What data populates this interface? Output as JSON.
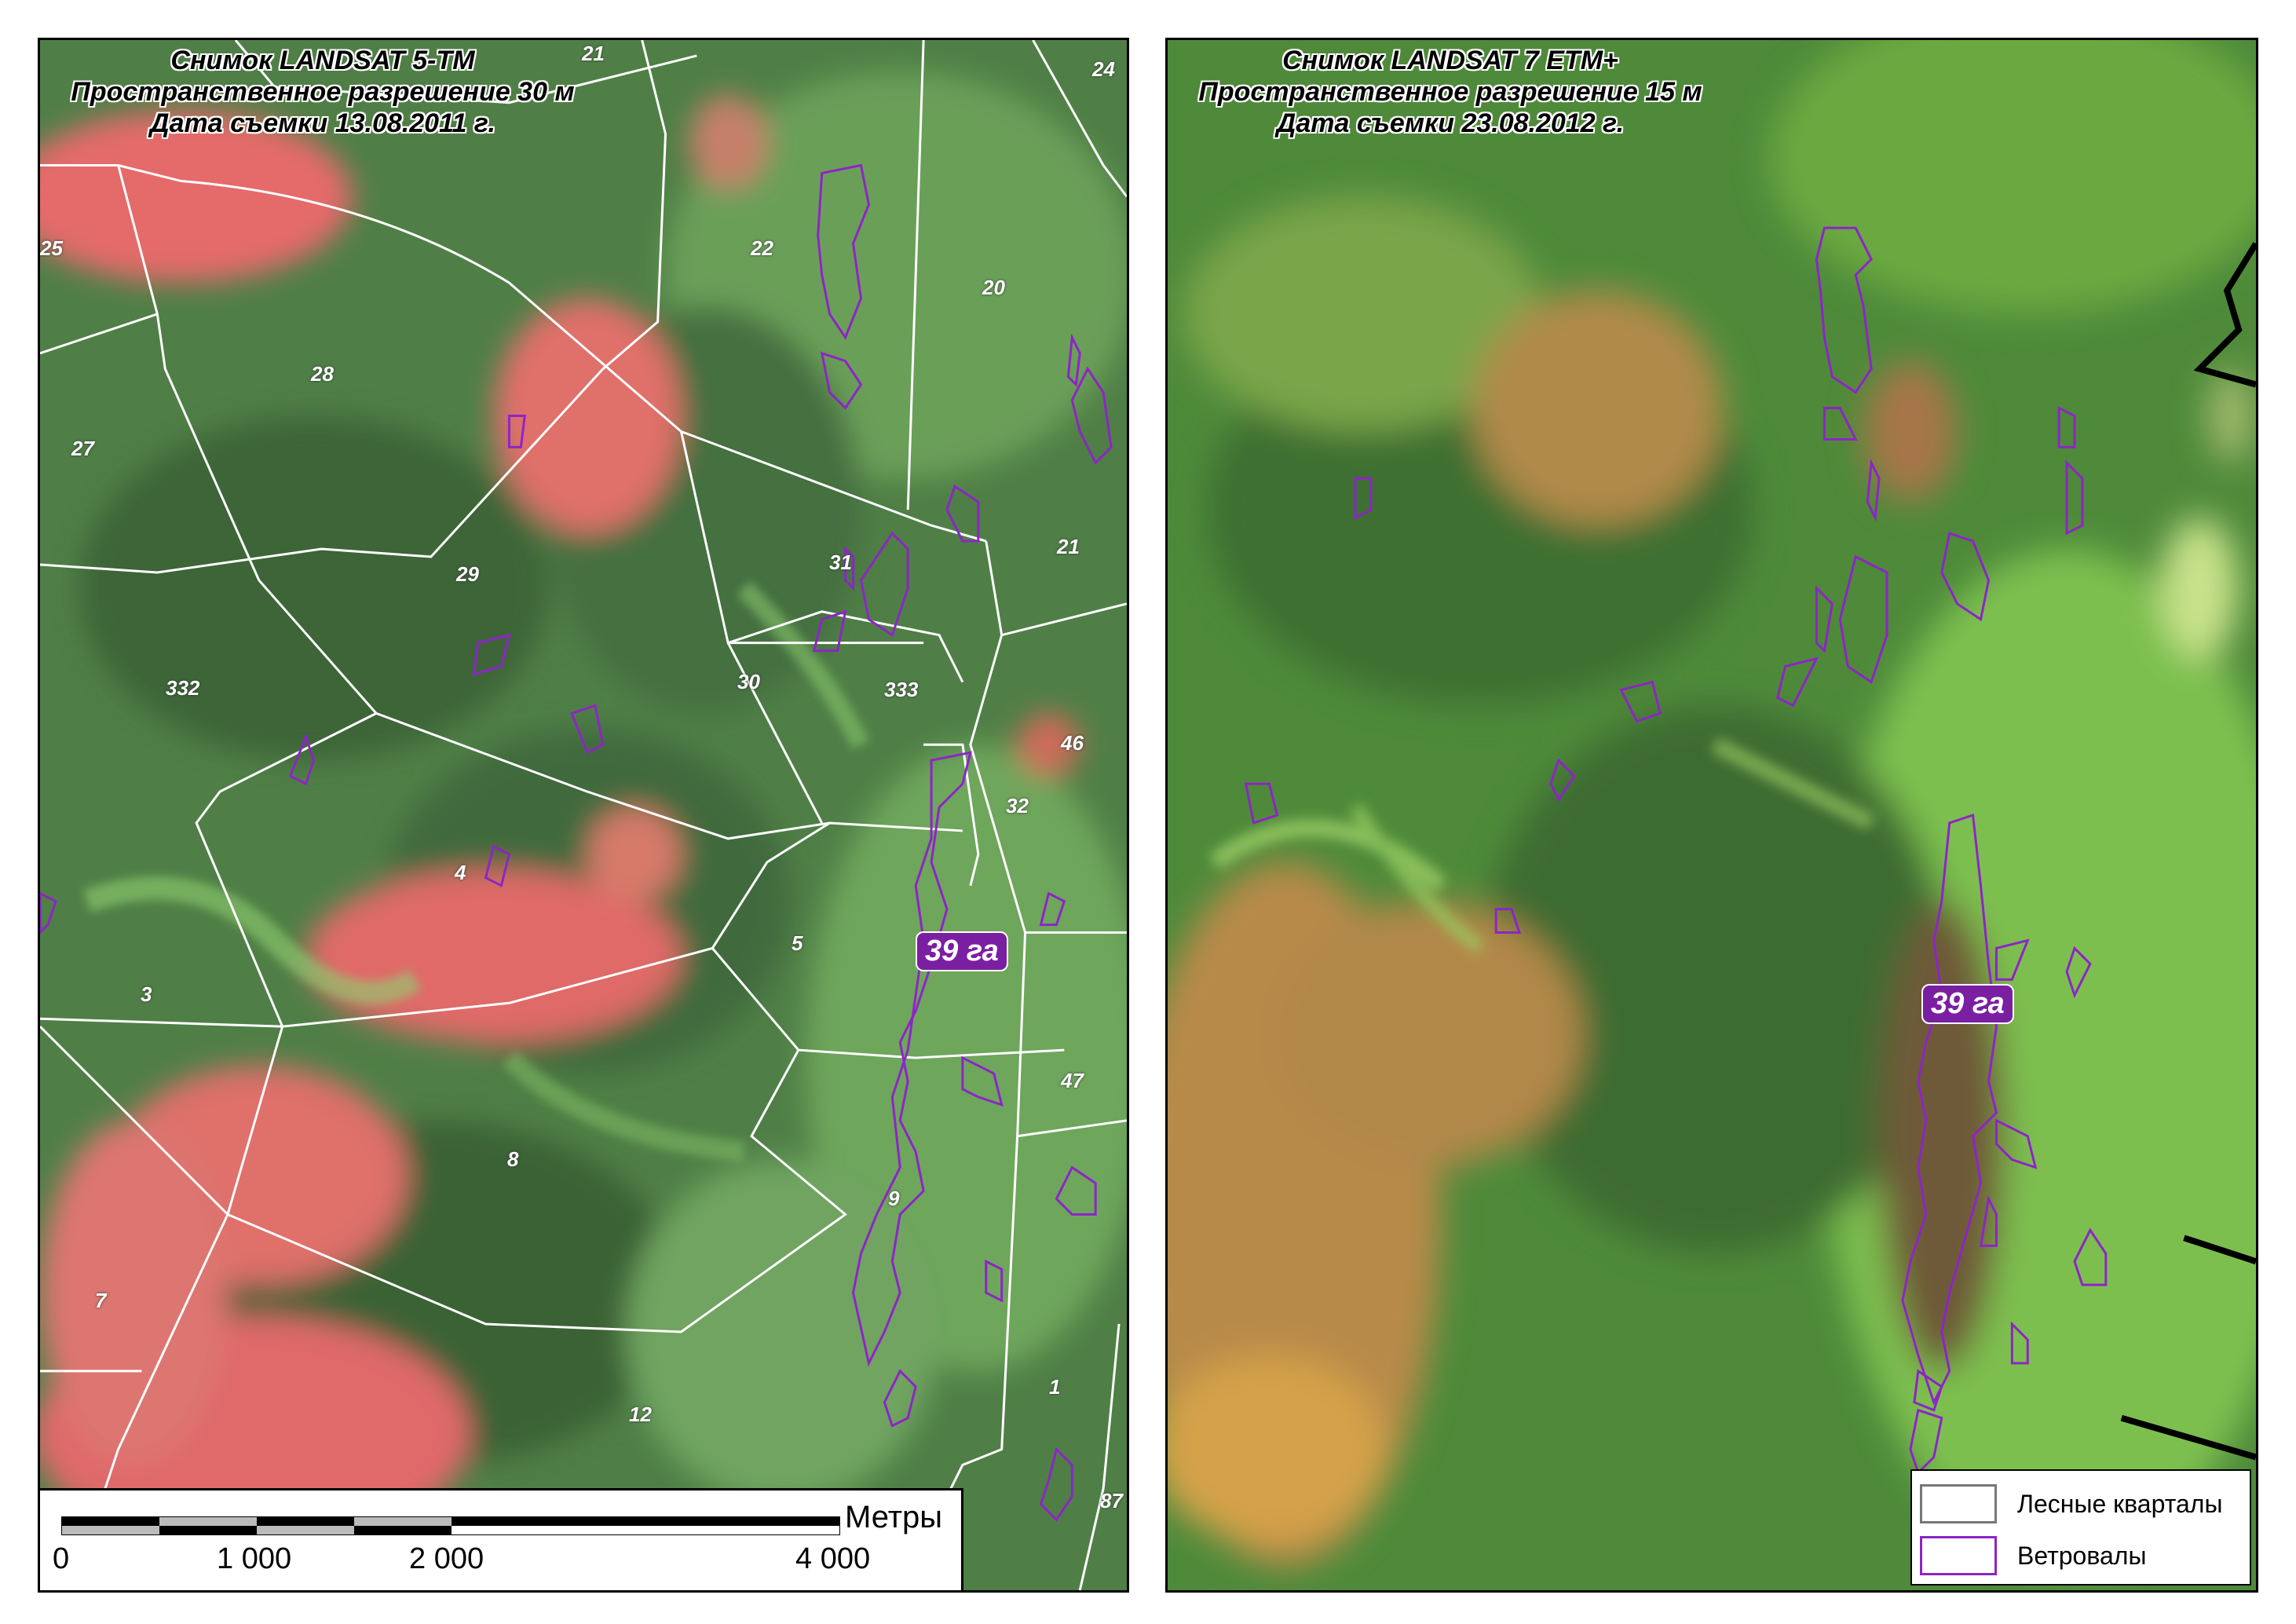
{
  "left_panel": {
    "title_lines": [
      "Снимок LANDSAT 5-TM",
      "Пространственное разрешение 30 м",
      "Дата съемки 13.08.2011 г."
    ],
    "quarter_labels": [
      "21",
      "24",
      "22",
      "20",
      "25",
      "28",
      "27",
      "21",
      "31",
      "29",
      "332",
      "30",
      "333",
      "46",
      "32",
      "4",
      "5",
      "3",
      "47",
      "8",
      "9",
      "7",
      "1",
      "12",
      "87"
    ],
    "area_label": "39 га",
    "scale_bar": {
      "unit": "Метры",
      "ticks": [
        "0",
        "1 000",
        "2 000",
        "4 000"
      ]
    }
  },
  "right_panel": {
    "title_lines": [
      "Снимок LANDSAT 7 ETM+",
      "Пространственное разрешение 15 м",
      "Дата съемки 23.08.2012 г."
    ],
    "area_label": "39 га",
    "legend": [
      {
        "label": "Лесные кварталы",
        "swatch_color": "#ffffff"
      },
      {
        "label": "Ветровалы",
        "swatch_color": "#8e24c8"
      }
    ]
  },
  "colors": {
    "forest_dark": "#3f6a3a",
    "forest_green": "#5f9450",
    "clearcut_pink": "#e56b6b",
    "boundary": "#ffffff",
    "windthrow": "#8e24c8",
    "etm_bright": "#7fc04a",
    "etm_orange": "#c48a45"
  }
}
